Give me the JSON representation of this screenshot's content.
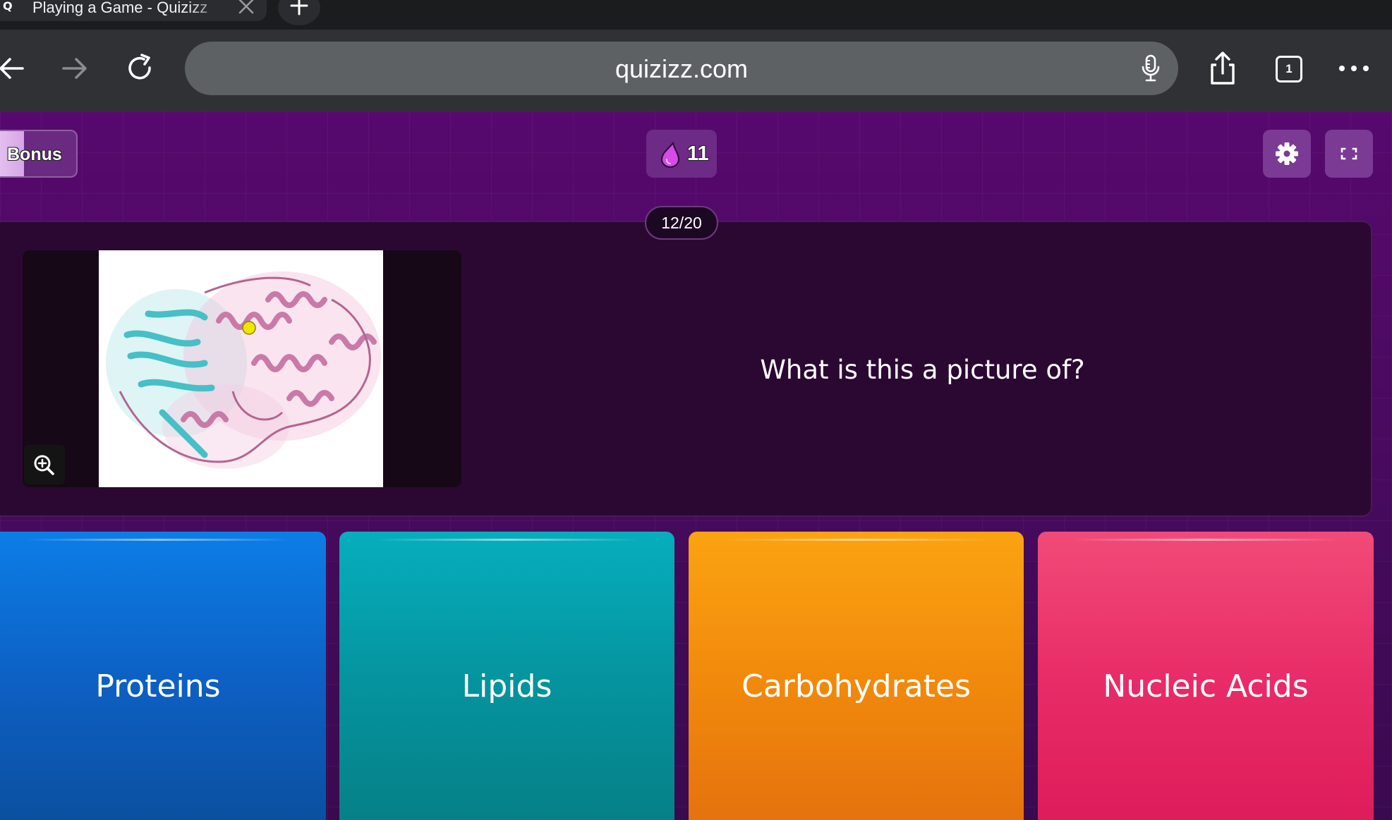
{
  "browser": {
    "tab": {
      "title": "Playing a Game - Quizizz",
      "favicon": "quizizz-q-icon"
    },
    "url": "quizizz.com",
    "tab_count": "1",
    "icons": [
      "back-arrow-icon",
      "forward-arrow-icon",
      "reload-icon",
      "microphone-icon",
      "share-icon",
      "tabs-icon",
      "more-icon",
      "close-icon",
      "plus-icon"
    ]
  },
  "game": {
    "bonus_label": "Bonus",
    "bonus_fill_fraction": 0.38,
    "streak_count": "11",
    "progress": "12/20",
    "question": "What is this a picture of?",
    "image_alt": "protein-ribbon-structure-image",
    "answers": [
      {
        "label": "Proteins",
        "color": "#0d67cc"
      },
      {
        "label": "Lipids",
        "color": "#05a0ad"
      },
      {
        "label": "Carbohydrates",
        "color": "#f2900c"
      },
      {
        "label": "Nucleic Acids",
        "color": "#e8336a"
      }
    ],
    "colors": {
      "background": "#4d0a63",
      "card": "#2b0832",
      "accent": "#d54ae8"
    }
  }
}
